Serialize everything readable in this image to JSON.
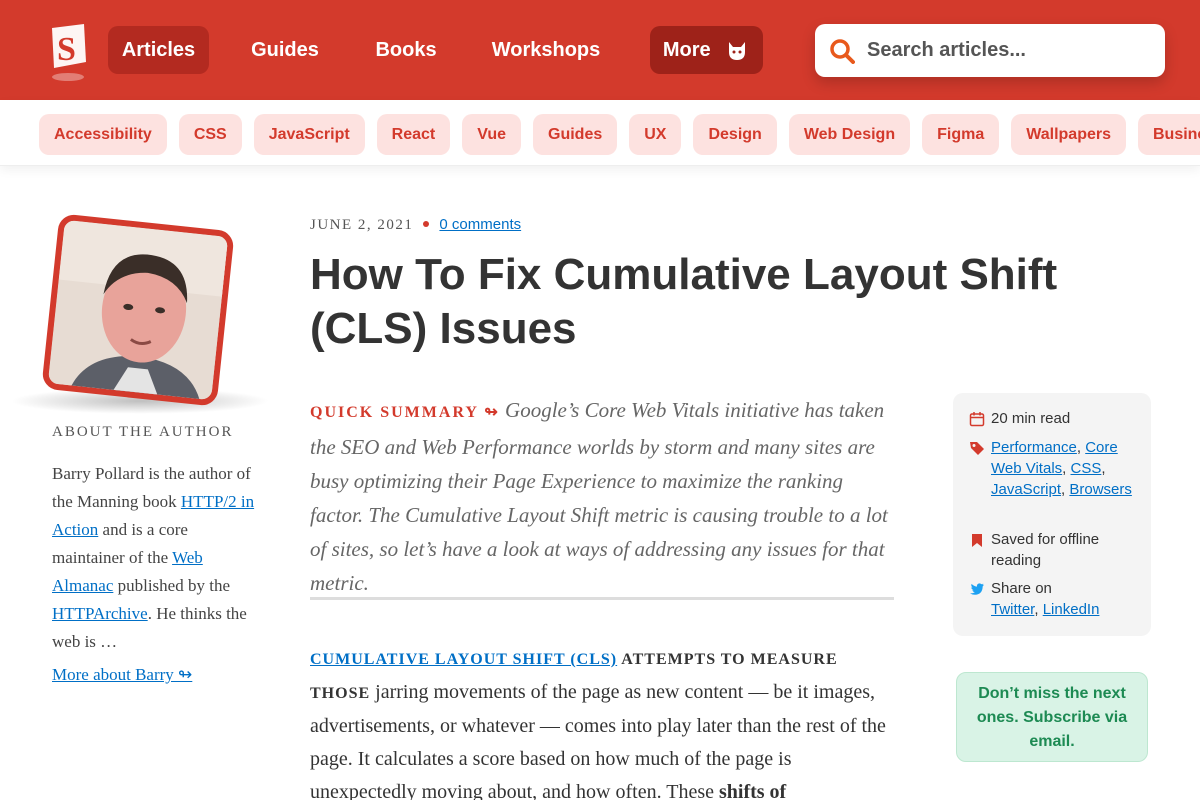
{
  "nav": {
    "logo_letter": "S",
    "items": [
      {
        "label": "Articles"
      },
      {
        "label": "Guides"
      },
      {
        "label": "Books"
      },
      {
        "label": "Workshops"
      },
      {
        "label": "More"
      }
    ],
    "search_placeholder": "Search articles..."
  },
  "tags": [
    "Accessibility",
    "CSS",
    "JavaScript",
    "React",
    "Vue",
    "Guides",
    "UX",
    "Design",
    "Web Design",
    "Figma",
    "Wallpapers",
    "Business"
  ],
  "author": {
    "about_title": "ABOUT THE AUTHOR",
    "bio_1": "Barry Pollard is the author of the Manning book ",
    "bio_link_1": "HTTP/2 in Action",
    "bio_2": " and is a core maintainer of the ",
    "bio_link_2": "Web Almanac",
    "bio_3": " published by the ",
    "bio_link_3": "HTTPArchive",
    "bio_4": ". He thinks the web is …",
    "more_link": "More about Barry ↬"
  },
  "article": {
    "date": "JUNE 2, 2021",
    "comments": "0 comments",
    "title": "How To Fix Cumulative Layout Shift (CLS) Issues",
    "summary_label": "QUICK SUMMARY ↬",
    "summary": " Google’s Core Web Vitals initiative has taken the SEO and Web Performance worlds by storm and many sites are busy optimizing their Page Experience to maximize the ranking factor. The Cumulative Layout Shift metric is causing trouble to a lot of sites, so let’s have a look at ways of addressing any issues for that metric.",
    "lead_link": "CUMULATIVE LAYOUT SHIFT (CLS)",
    "lead_rest": " ATTEMPTS TO MEASURE THOSE",
    "body": " jarring movements of the page as new content — be it images, advertisements, or whatever — comes into play later than the rest of the page. It calculates a score based on how much of the page is unexpectedly moving about, and how often. These ",
    "body_bold": "shifts of"
  },
  "info": {
    "read_time": "20 min read",
    "tags": [
      "Performance",
      "Core Web Vitals",
      "CSS",
      "JavaScript",
      "Browsers"
    ],
    "saved": "Saved for offline reading",
    "share_label": "Share on",
    "share_links": [
      "Twitter",
      "LinkedIn"
    ]
  },
  "subscribe": "Don’t miss the next ones. Subscribe via email.",
  "colors": {
    "brand": "#d33a2c",
    "link": "#006fc6",
    "subscribe": "#1d8a53"
  }
}
